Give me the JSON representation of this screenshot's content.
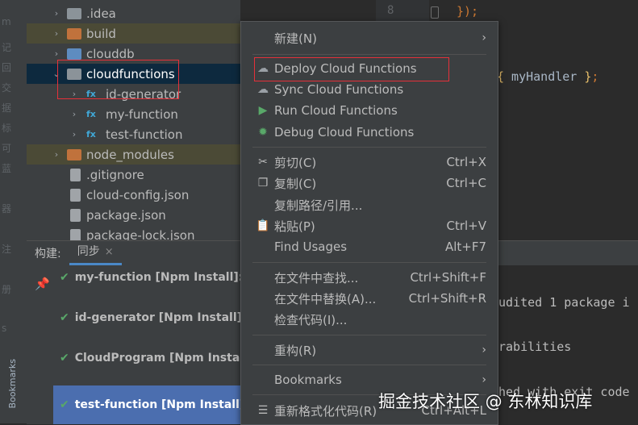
{
  "colors": {
    "accent": "#4b6eaf",
    "highlight_box": "#e5303a",
    "check": "#59a869",
    "run_icon": "#59a869",
    "debug_icon": "#59a869",
    "fx_icon": "#40a7d6"
  },
  "left_strip": {
    "bookmarks_label": "Bookmarks",
    "fragments": [
      "记",
      "交",
      "标",
      "蓝",
      "器",
      "注",
      "册",
      "s",
      "m",
      "回",
      "据",
      "可"
    ]
  },
  "tree": {
    "items": [
      {
        "label": ".idea",
        "icon": "folder-icon",
        "expandable": true
      },
      {
        "label": "build",
        "icon": "folder-icon",
        "expandable": true
      },
      {
        "label": "clouddb",
        "icon": "folder-icon",
        "expandable": true
      },
      {
        "label": "cloudfunctions",
        "icon": "folder-icon",
        "expandable": true,
        "expanded": true
      },
      {
        "label": "id-generator",
        "icon": "function-icon",
        "expandable": true
      },
      {
        "label": "my-function",
        "icon": "function-icon",
        "expandable": true
      },
      {
        "label": "test-function",
        "icon": "function-icon",
        "expandable": true
      },
      {
        "label": "node_modules",
        "icon": "folder-icon",
        "expandable": true
      },
      {
        "label": ".gitignore",
        "icon": "file-icon"
      },
      {
        "label": "cloud-config.json",
        "icon": "json-file-icon"
      },
      {
        "label": "package.json",
        "icon": "json-file-icon"
      },
      {
        "label": "package-lock.json",
        "icon": "json-file-icon"
      }
    ]
  },
  "editor": {
    "line_number": "8",
    "line_8_code": "});",
    "code_open": "{",
    "code_name": " myHandler ",
    "code_close": "}",
    "code_semi": ";"
  },
  "bottom": {
    "tabs": [
      {
        "label": "构建:"
      },
      {
        "label": "同步",
        "close": "×"
      }
    ],
    "build_items": [
      {
        "label": "my-function [Npm Install]:"
      },
      {
        "label": "id-generator [Npm Install]:"
      },
      {
        "label": "CloudProgram [Npm Instal"
      },
      {
        "label": "test-function [Npm Install]"
      }
    ],
    "console_lines": [
      "udited 1 package i",
      "rabilities",
      "hed with exit code"
    ]
  },
  "context_menu": {
    "items": [
      {
        "label": "新建(N)",
        "submenu": true
      },
      {
        "label": "Deploy Cloud Functions",
        "icon": "cloud-upload-icon"
      },
      {
        "label": "Sync Cloud Functions",
        "icon": "cloud-sync-icon"
      },
      {
        "label": "Run Cloud Functions",
        "icon": "run-icon"
      },
      {
        "label": "Debug Cloud Functions",
        "icon": "debug-icon"
      },
      {
        "label": "剪切(C)",
        "shortcut": "Ctrl+X",
        "icon": "cut-icon"
      },
      {
        "label": "复制(C)",
        "shortcut": "Ctrl+C",
        "icon": "copy-icon"
      },
      {
        "label": "复制路径/引用..."
      },
      {
        "label": "粘贴(P)",
        "shortcut": "Ctrl+V",
        "icon": "paste-icon"
      },
      {
        "label": "Find Usages",
        "shortcut": "Alt+F7"
      },
      {
        "label": "在文件中查找...",
        "shortcut": "Ctrl+Shift+F"
      },
      {
        "label": "在文件中替换(A)...",
        "shortcut": "Ctrl+Shift+R"
      },
      {
        "label": "检查代码(I)..."
      },
      {
        "label": "重构(R)",
        "submenu": true
      },
      {
        "label": "Bookmarks",
        "submenu": true
      },
      {
        "label": "重新格式化代码(R)",
        "shortcut": "Ctrl+Alt+L",
        "icon": "reformat-icon"
      }
    ]
  },
  "watermark": "掘金技术社区 @ 东林知识库"
}
